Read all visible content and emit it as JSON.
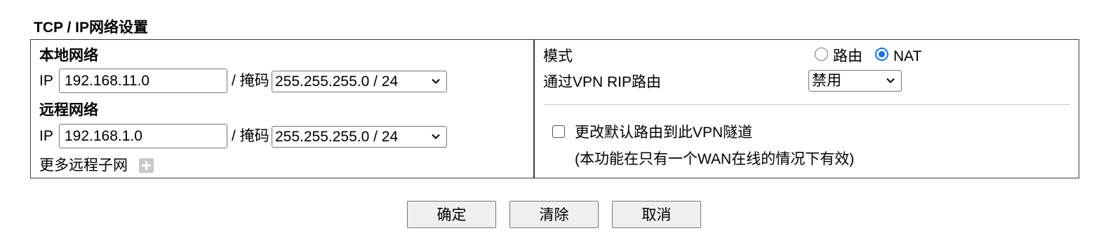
{
  "section": {
    "title": "TCP / IP网络设置"
  },
  "local_network": {
    "heading": "本地网络",
    "ip_label": "IP",
    "ip_value": "192.168.11.0",
    "mask_label": "/ 掩码",
    "mask_value": "255.255.255.0 / 24"
  },
  "remote_network": {
    "heading": "远程网络",
    "ip_label": "IP",
    "ip_value": "192.168.1.0",
    "mask_label": "/ 掩码",
    "mask_value": "255.255.255.0 / 24",
    "more_subnets_label": "更多远程子网"
  },
  "mode": {
    "label": "模式",
    "options": [
      {
        "label": "路由",
        "selected": false
      },
      {
        "label": "NAT",
        "selected": true
      }
    ]
  },
  "rip": {
    "label": "通过VPN RIP路由",
    "value": "禁用"
  },
  "default_route": {
    "label": "更改默认路由到此VPN隧道",
    "note": "(本功能在只有一个WAN在线的情况下有效)",
    "checked": false
  },
  "buttons": {
    "ok": "确定",
    "clear": "清除",
    "cancel": "取消"
  },
  "colors": {
    "radio_selected": "#1a73e8",
    "border": "#3a3a3a",
    "button_bg": "#efefef"
  }
}
